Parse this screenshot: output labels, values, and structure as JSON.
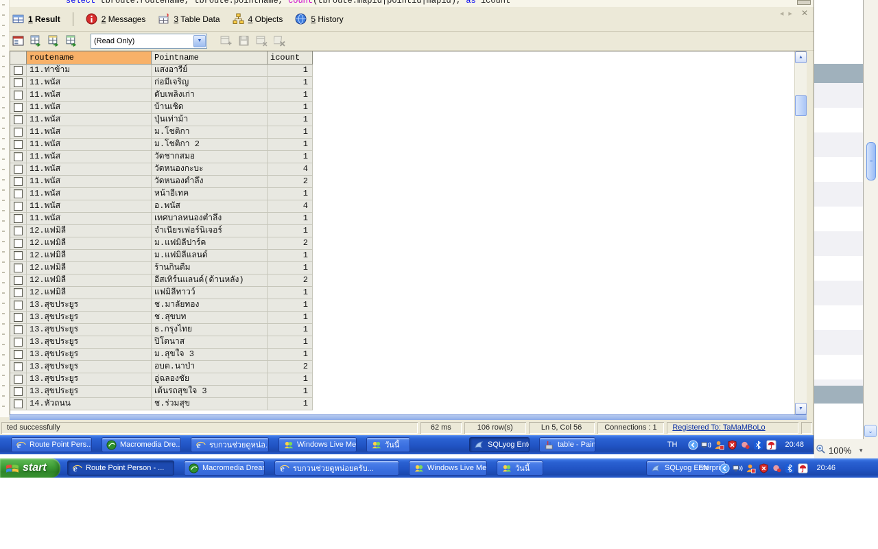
{
  "sql_editor": {
    "tokens": [
      {
        "text": "select ",
        "color": "#0000ee"
      },
      {
        "text": "tbroute.routename, tbroute.pointname, ",
        "color": "#1a1a1a"
      },
      {
        "text": "count",
        "color": "#cc00cc"
      },
      {
        "text": "(tbroute.mapid|pointid|mapid), ",
        "color": "#1a1a1a"
      },
      {
        "text": "as",
        "color": "#0000ee"
      },
      {
        "text": " icount",
        "color": "#1a1a1a"
      }
    ]
  },
  "tabs": {
    "items": [
      {
        "number": "1",
        "label": "Result",
        "icon": "result-grid",
        "active": true
      },
      {
        "number": "2",
        "label": "Messages",
        "icon": "messages",
        "active": false
      },
      {
        "number": "3",
        "label": "Table Data",
        "icon": "table-data",
        "active": false
      },
      {
        "number": "4",
        "label": "Objects",
        "icon": "objects",
        "active": false
      },
      {
        "number": "5",
        "label": "History",
        "icon": "history",
        "active": false
      }
    ]
  },
  "toolbar": {
    "mode": "(Read Only)",
    "left_icons": [
      "form-view",
      "export-result",
      "export-csv",
      "export-xml"
    ],
    "right_icons": [
      "insert-row",
      "save-changes",
      "delete-row",
      "stop-query"
    ]
  },
  "grid": {
    "columns": [
      "routename",
      "Pointname",
      "icount"
    ],
    "rows": [
      {
        "routename": "11.ท่าข้าม",
        "pointname": "แสงอารีย์",
        "icount": "1"
      },
      {
        "routename": "11.พนัส",
        "pointname": "ก่อมีเจริญ",
        "icount": "1"
      },
      {
        "routename": "11.พนัส",
        "pointname": "ดับเพลิงเก่า",
        "icount": "1"
      },
      {
        "routename": "11.พนัส",
        "pointname": "บ้านเชิด",
        "icount": "1"
      },
      {
        "routename": "11.พนัส",
        "pointname": "ปุ่นเท่าม้า",
        "icount": "1"
      },
      {
        "routename": "11.พนัส",
        "pointname": "ม.โชติกา",
        "icount": "1"
      },
      {
        "routename": "11.พนัส",
        "pointname": "ม.โชติกา 2",
        "icount": "1"
      },
      {
        "routename": "11.พนัส",
        "pointname": "วัดชากสมอ",
        "icount": "1"
      },
      {
        "routename": "11.พนัส",
        "pointname": "วัดหนองกะบะ",
        "icount": "4"
      },
      {
        "routename": "11.พนัส",
        "pointname": "วัดหนองตำลึง",
        "icount": "2"
      },
      {
        "routename": "11.พนัส",
        "pointname": "หน้าอีเทค",
        "icount": "1"
      },
      {
        "routename": "11.พนัส",
        "pointname": "อ.พนัส",
        "icount": "4"
      },
      {
        "routename": "11.พนัส",
        "pointname": "เทศบาลหนองตำลึง",
        "icount": "1"
      },
      {
        "routename": "12.แฟมิลี่",
        "pointname": "จำเนียรเฟอร์นิเจอร์",
        "icount": "1"
      },
      {
        "routename": "12.แฟมิลี่",
        "pointname": "ม.แฟมิลี่ปาร์ค",
        "icount": "2"
      },
      {
        "routename": "12.แฟมิลี่",
        "pointname": "ม.แฟมิลี่แลนด์",
        "icount": "1"
      },
      {
        "routename": "12.แฟมิลี่",
        "pointname": "ร้านกินดื่ม",
        "icount": "1"
      },
      {
        "routename": "12.แฟมิลี่",
        "pointname": "อีสเทิร์นแลนด์(ด้านหลัง)",
        "icount": "2"
      },
      {
        "routename": "12.แฟมิลี่",
        "pointname": "แฟมิลี่ทาวว์",
        "icount": "1"
      },
      {
        "routename": "13.สุขประยูร",
        "pointname": "ช.มาลัยทอง",
        "icount": "1"
      },
      {
        "routename": "13.สุขประยูร",
        "pointname": "ช.สุขบท",
        "icount": "1"
      },
      {
        "routename": "13.สุขประยูร",
        "pointname": "ธ.กรุงไทย",
        "icount": "1"
      },
      {
        "routename": "13.สุขประยูร",
        "pointname": "ปิโตนาส",
        "icount": "1"
      },
      {
        "routename": "13.สุขประยูร",
        "pointname": "ม.สุขใจ 3",
        "icount": "1"
      },
      {
        "routename": "13.สุขประยูร",
        "pointname": "อบต.นาป่า",
        "icount": "2"
      },
      {
        "routename": "13.สุขประยูร",
        "pointname": "อู่ฉลองชัย",
        "icount": "1"
      },
      {
        "routename": "13.สุขประยูร",
        "pointname": "เต้นรถสุขใจ 3",
        "icount": "1"
      },
      {
        "routename": "14.หัวถนน",
        "pointname": "ช.ร่วมสุข",
        "icount": "1"
      }
    ]
  },
  "statusbar": {
    "message": "ted successfully",
    "duration": "62 ms",
    "row_count": "106 row(s)",
    "cursor": "Ln 5, Col 56",
    "connections": "Connections : 1",
    "registered": "Registered To: TaMaMBoLo"
  },
  "taskbar_inner": {
    "buttons": [
      {
        "icon": "ie",
        "label": "Route Point Pers...",
        "pressed": false
      },
      {
        "icon": "dreamweaver",
        "label": "Macromedia Dre...",
        "pressed": false
      },
      {
        "icon": "ie",
        "label": "รบกวนช่วยดูหน่อ...",
        "pressed": false
      },
      {
        "icon": "messenger",
        "label": "Windows Live Me...",
        "pressed": false
      },
      {
        "icon": "messenger",
        "label": "วันนี้",
        "pressed": false
      },
      {
        "icon": "sqlyog",
        "label": "SQLyog Enterpri...",
        "pressed": true
      },
      {
        "icon": "paint",
        "label": "table - Paint",
        "pressed": false
      }
    ],
    "language": "TH",
    "tray_icons": [
      "tray-chevron",
      "network",
      "person-status",
      "shield-alert",
      "badge",
      "bluetooth",
      "avira"
    ],
    "clock": "20:48"
  },
  "taskbar_outer": {
    "start_label": "start",
    "buttons": [
      {
        "icon": "ie",
        "label": "Route Point Person - ...",
        "pressed": true
      },
      {
        "icon": "dreamweaver",
        "label": "Macromedia Dreamw...",
        "pressed": false
      },
      {
        "icon": "ie",
        "label": "รบกวนช่วยดูหน่อยครับ...",
        "pressed": false
      },
      {
        "icon": "messenger",
        "label": "Windows Live Messen...",
        "pressed": false
      },
      {
        "icon": "messenger",
        "label": "วันนี้",
        "pressed": false
      },
      {
        "icon": "sqlyog",
        "label": "SQLyog Enterprise - ...",
        "pressed": false
      }
    ],
    "language": "EN",
    "tray_icons": [
      "tray-chevron",
      "network",
      "person-status",
      "shield-alert",
      "badge",
      "bluetooth",
      "avira"
    ],
    "clock": "20:46"
  },
  "zoom_control": {
    "value": "100%"
  },
  "colors": {
    "header_highlight": "#f8b169",
    "taskbar_blue": "#2154c4",
    "status_link": "#0a2fa4",
    "grid_row_bg": "#e8e8e1",
    "toolbar_beige": "#ece9d8"
  }
}
